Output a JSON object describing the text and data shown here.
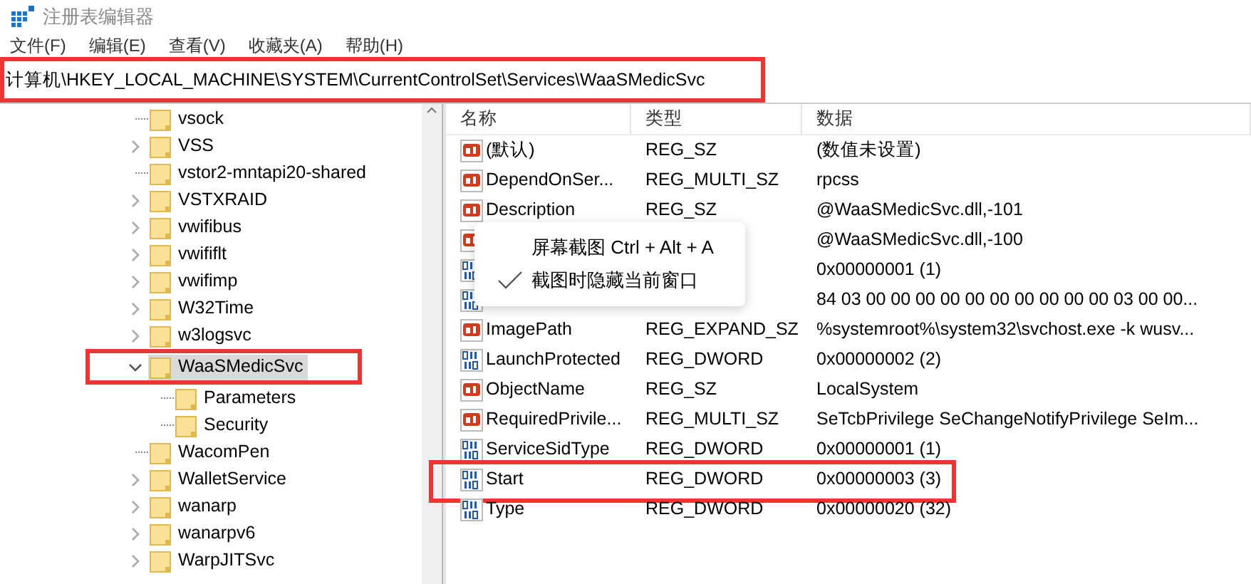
{
  "window": {
    "title": "注册表编辑器"
  },
  "menu": [
    "文件(F)",
    "编辑(E)",
    "查看(V)",
    "收藏夹(A)",
    "帮助(H)"
  ],
  "address_bar": {
    "value": "计算机\\HKEY_LOCAL_MACHINE\\SYSTEM\\CurrentControlSet\\Services\\WaaSMedicSvc",
    "annotated": true
  },
  "tree": [
    {
      "label": "vsock",
      "has_children": false,
      "selected": false,
      "annotated": false
    },
    {
      "label": "VSS",
      "has_children": true,
      "expanded": false,
      "selected": false,
      "annotated": false
    },
    {
      "label": "vstor2-mntapi20-shared",
      "has_children": false,
      "selected": false,
      "annotated": false
    },
    {
      "label": "VSTXRAID",
      "has_children": true,
      "expanded": false,
      "selected": false,
      "annotated": false
    },
    {
      "label": "vwifibus",
      "has_children": true,
      "expanded": false,
      "selected": false,
      "annotated": false
    },
    {
      "label": "vwififlt",
      "has_children": true,
      "expanded": false,
      "selected": false,
      "annotated": false
    },
    {
      "label": "vwifimp",
      "has_children": true,
      "expanded": false,
      "selected": false,
      "annotated": false
    },
    {
      "label": "W32Time",
      "has_children": true,
      "expanded": false,
      "selected": false,
      "annotated": false
    },
    {
      "label": "w3logsvc",
      "has_children": true,
      "expanded": false,
      "selected": false,
      "annotated": false
    },
    {
      "label": "WaaSMedicSvc",
      "has_children": true,
      "expanded": true,
      "selected": true,
      "annotated": true,
      "children": [
        {
          "label": "Parameters",
          "has_children": false,
          "selected": false,
          "annotated": false
        },
        {
          "label": "Security",
          "has_children": false,
          "selected": false,
          "annotated": false
        }
      ]
    },
    {
      "label": "WacomPen",
      "has_children": false,
      "selected": false,
      "annotated": false
    },
    {
      "label": "WalletService",
      "has_children": true,
      "expanded": false,
      "selected": false,
      "annotated": false
    },
    {
      "label": "wanarp",
      "has_children": true,
      "expanded": false,
      "selected": false,
      "annotated": false
    },
    {
      "label": "wanarpv6",
      "has_children": true,
      "expanded": false,
      "selected": false,
      "annotated": false
    },
    {
      "label": "WarpJITSvc",
      "has_children": true,
      "expanded": false,
      "selected": false,
      "annotated": false
    }
  ],
  "table": {
    "columns": [
      "名称",
      "类型",
      "数据"
    ],
    "rows": [
      {
        "kind": "string",
        "name": "(默认)",
        "type": "REG_SZ",
        "data": "(数值未设置)",
        "annotated": false
      },
      {
        "kind": "string",
        "name": "DependOnSer...",
        "type": "REG_MULTI_SZ",
        "data": "rpcss",
        "annotated": false
      },
      {
        "kind": "string",
        "name": "Description",
        "type": "REG_SZ",
        "data": "@WaaSMedicSvc.dll,-101",
        "annotated": false
      },
      {
        "kind": "string",
        "data": "@WaaSMedicSvc.dll,-100",
        "annotated": false
      },
      {
        "kind": "binary",
        "data": "0x00000001 (1)",
        "annotated": false
      },
      {
        "kind": "binary",
        "data": "84 03 00 00 00 00 00 00 00 00 00 00 03 00 00...",
        "annotated": false
      },
      {
        "kind": "string",
        "name": "ImagePath",
        "type": "REG_EXPAND_SZ",
        "data": "%systemroot%\\system32\\svchost.exe -k wusv...",
        "annotated": false
      },
      {
        "kind": "binary",
        "name": "LaunchProtected",
        "type": "REG_DWORD",
        "data": "0x00000002 (2)",
        "annotated": false
      },
      {
        "kind": "string",
        "name": "ObjectName",
        "type": "REG_SZ",
        "data": "LocalSystem",
        "annotated": false
      },
      {
        "kind": "string",
        "name": "RequiredPrivile...",
        "type": "REG_MULTI_SZ",
        "data": "SeTcbPrivilege SeChangeNotifyPrivilege SeIm...",
        "annotated": false
      },
      {
        "kind": "binary",
        "name": "ServiceSidType",
        "type": "REG_DWORD",
        "data": "0x00000001 (1)",
        "annotated": false
      },
      {
        "kind": "binary",
        "name": "Start",
        "type": "REG_DWORD",
        "data": "0x00000003 (3)",
        "annotated": true
      },
      {
        "kind": "binary",
        "name": "Type",
        "type": "REG_DWORD",
        "data": "0x00000020 (32)",
        "annotated": false
      }
    ]
  },
  "popup_menu": [
    {
      "label": "屏幕截图 Ctrl + Alt + A",
      "checked": false
    },
    {
      "label": "截图时隐藏当前窗口",
      "checked": true
    }
  ]
}
